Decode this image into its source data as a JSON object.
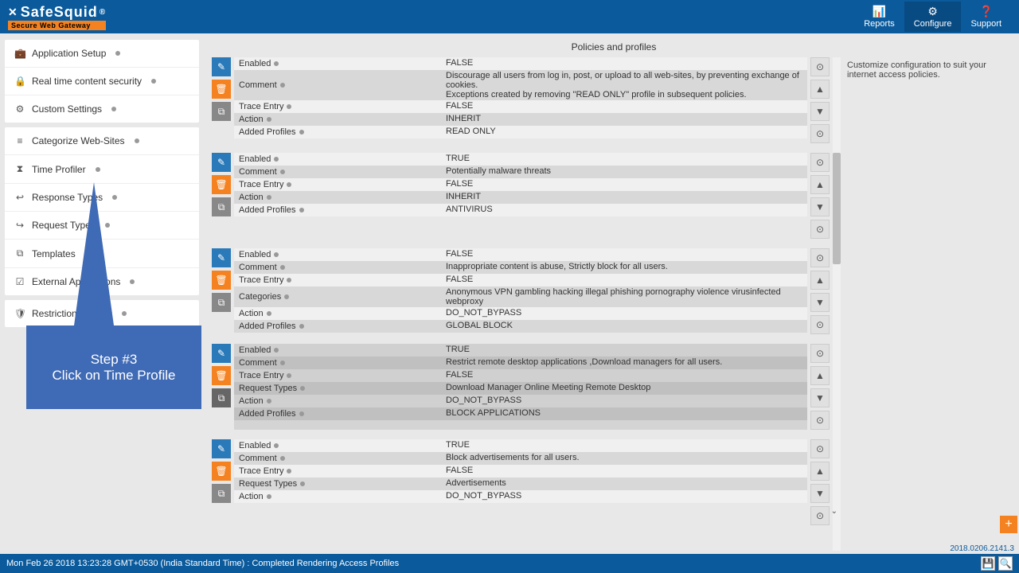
{
  "brand": {
    "name": "SafeSquid",
    "tagline": "Secure Web Gateway"
  },
  "header_buttons": [
    {
      "icon": "📊",
      "label": "Reports"
    },
    {
      "icon": "⚙",
      "label": "Configure",
      "active": true
    },
    {
      "icon": "❓",
      "label": "Support"
    }
  ],
  "sidebar": {
    "groups": [
      [
        {
          "icon": "💼",
          "label": "Application Setup"
        },
        {
          "icon": "🔒",
          "label": "Real time content security"
        },
        {
          "icon": "⚙",
          "label": "Custom Settings"
        }
      ],
      [
        {
          "icon": "≡",
          "label": "Categorize Web-Sites"
        },
        {
          "icon": "⧗",
          "label": "Time Profiler"
        },
        {
          "icon": "↩",
          "label": "Response Types"
        },
        {
          "icon": "↪",
          "label": "Request Types"
        },
        {
          "icon": "⧉",
          "label": "Templates"
        },
        {
          "icon": "☑",
          "label": "External Applications"
        }
      ],
      [
        {
          "icon": "🛡",
          "label": "Restriction Policies"
        }
      ]
    ]
  },
  "content": {
    "title": "Policies and profiles",
    "right_text": "Customize configuration to suit your internet access policies."
  },
  "rules": [
    {
      "rows": [
        {
          "label": "Enabled",
          "value": "FALSE"
        },
        {
          "label": "Comment",
          "value": "Discourage all users from log in, post, or upload to all web-sites, by preventing exchange of cookies.\nExceptions created by removing \"READ ONLY\" profile in subsequent policies."
        },
        {
          "label": "Trace Entry",
          "value": "FALSE"
        },
        {
          "label": "Action",
          "value": "INHERIT"
        },
        {
          "label": "Added Profiles",
          "value": "READ ONLY"
        }
      ]
    },
    {
      "rows": [
        {
          "label": "Enabled",
          "value": "TRUE"
        },
        {
          "label": "Comment",
          "value": "Potentially malware threats"
        },
        {
          "label": "Trace Entry",
          "value": "FALSE"
        },
        {
          "label": "Action",
          "value": "INHERIT"
        },
        {
          "label": "Added Profiles",
          "value": "ANTIVIRUS"
        }
      ]
    },
    {
      "rows": [
        {
          "label": "Enabled",
          "value": "FALSE"
        },
        {
          "label": "Comment",
          "value": "Inappropriate content is abuse, Strictly block for all users."
        },
        {
          "label": "Trace Entry",
          "value": "FALSE"
        },
        {
          "label": "Categories",
          "value": "Anonymous VPN  gambling  hacking  illegal  phishing  pornography  violence  virusinfected  webproxy"
        },
        {
          "label": "Action",
          "value": "DO_NOT_BYPASS"
        },
        {
          "label": "Added Profiles",
          "value": "GLOBAL BLOCK"
        }
      ]
    },
    {
      "selected": true,
      "rows": [
        {
          "label": "Enabled",
          "value": "TRUE"
        },
        {
          "label": "Comment",
          "value": "Restrict remote desktop applications ,Download managers for all users."
        },
        {
          "label": "Trace Entry",
          "value": "FALSE"
        },
        {
          "label": "Request Types",
          "value": "Download Manager  Online Meeting  Remote Desktop"
        },
        {
          "label": "Action",
          "value": "DO_NOT_BYPASS"
        },
        {
          "label": "Added Profiles",
          "value": "BLOCK APPLICATIONS"
        }
      ]
    },
    {
      "rows": [
        {
          "label": "Enabled",
          "value": "TRUE"
        },
        {
          "label": "Comment",
          "value": "Block advertisements for all users."
        },
        {
          "label": "Trace Entry",
          "value": "FALSE"
        },
        {
          "label": "Request Types",
          "value": "Advertisements"
        },
        {
          "label": "Action",
          "value": "DO_NOT_BYPASS"
        }
      ]
    }
  ],
  "callout": {
    "line1": "Step #3",
    "line2": "Click on Time Profile"
  },
  "footer": {
    "status": "Mon Feb 26 2018 13:23:28 GMT+0530 (India Standard Time) : Completed Rendering Access Profiles",
    "version": "2018.0206.2141.3"
  }
}
